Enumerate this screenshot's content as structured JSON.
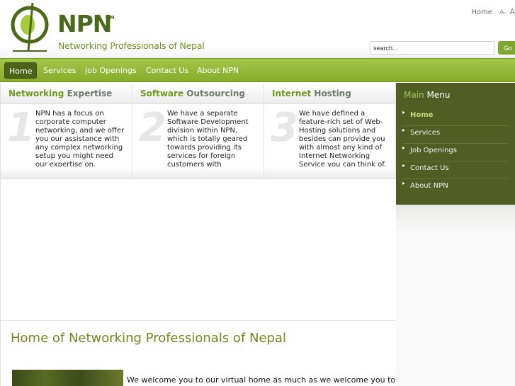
{
  "header": {
    "logo": {
      "name": "NPN",
      "trademark": "TM",
      "tagline": "Networking Professionals of Nepal"
    },
    "top_links": {
      "home": "Home",
      "font_smaller": "A-",
      "font_larger": "A"
    },
    "search": {
      "placeholder": "search...",
      "button": "Go"
    }
  },
  "nav": {
    "items": [
      {
        "label": "Home",
        "active": true
      },
      {
        "label": "Services"
      },
      {
        "label": "Job Openings"
      },
      {
        "label": "Contact Us"
      },
      {
        "label": "About NPN"
      }
    ]
  },
  "features": [
    {
      "title_highlight": "Networking",
      "title_rest": " Expertise",
      "number": "1",
      "text": "NPN has a focus on corporate computer networking, and we offer you our assistance with any complex networking setup you might need our expertise on."
    },
    {
      "title_highlight": "Software",
      "title_rest": " Outsourcing",
      "number": "2",
      "text": "We have a separate Software Development division within NPN, which is totally geared towards providing its services for foreign customers with programming needs."
    },
    {
      "title_highlight": "Internet",
      "title_rest": " Hosting",
      "number": "3",
      "text": "We have defined a feature-rich set of Web-Hosting solutions and besides can provide you with almost any kind of Internet Networking Service you can think of."
    }
  ],
  "main": {
    "heading": "Home of Networking Professionals of Nepal",
    "welcome": "We welcome you to our virtual home as much as we welcome you to"
  },
  "sidebar": {
    "title_highlight": "Main",
    "title_rest": " Menu",
    "items": [
      {
        "label": "Home",
        "active": true
      },
      {
        "label": "Services"
      },
      {
        "label": "Job Openings"
      },
      {
        "label": "Contact Us"
      },
      {
        "label": "About NPN"
      }
    ]
  },
  "colors": {
    "brand_green": "#87ab2b",
    "dark_green": "#505e23",
    "accent_text": "#6e9a1f"
  }
}
